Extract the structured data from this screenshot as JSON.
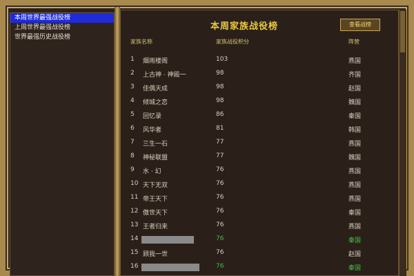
{
  "left_panel": {
    "items": [
      {
        "label": "本周世界最强战役榜",
        "selected": true
      },
      {
        "label": "上周世界最强战役榜",
        "selected": false
      },
      {
        "label": "世界最强历史战役榜",
        "selected": false
      }
    ]
  },
  "main": {
    "title": "本周家族战役榜",
    "action_button": "查看战榜",
    "columns": {
      "name": "家族名称",
      "score": "家族战役积分",
      "camp": "阵营"
    },
    "rows": [
      {
        "rank": "1",
        "name": "烟雨楼阁",
        "score": "103",
        "camp": "燕国"
      },
      {
        "rank": "2",
        "name": "上古神 · 神殿一",
        "score": "98",
        "camp": "齐国"
      },
      {
        "rank": "3",
        "name": "佳偶天成",
        "score": "98",
        "camp": "赵国"
      },
      {
        "rank": "4",
        "name": "倾城之恋",
        "score": "98",
        "camp": "魏国"
      },
      {
        "rank": "5",
        "name": "回忆录",
        "score": "86",
        "camp": "秦国"
      },
      {
        "rank": "6",
        "name": "风华者",
        "score": "81",
        "camp": "韩国"
      },
      {
        "rank": "7",
        "name": "三生一石",
        "score": "77",
        "camp": "燕国"
      },
      {
        "rank": "8",
        "name": "神秘联盟",
        "score": "77",
        "camp": "魏国"
      },
      {
        "rank": "9",
        "name": "水 · 幻",
        "score": "76",
        "camp": "燕国"
      },
      {
        "rank": "10",
        "name": "天下无双",
        "score": "76",
        "camp": "燕国"
      },
      {
        "rank": "11",
        "name": "帝王天下",
        "score": "76",
        "camp": "燕国"
      },
      {
        "rank": "12",
        "name": "傲世天下",
        "score": "76",
        "camp": "秦国"
      },
      {
        "rank": "13",
        "name": "王者归来",
        "score": "76",
        "camp": "燕国"
      },
      {
        "rank": "14",
        "name": "",
        "score": "76",
        "camp": "秦国",
        "highlight": true
      },
      {
        "rank": "15",
        "name": "顾我一世",
        "score": "76",
        "camp": "赵国"
      },
      {
        "rank": "16",
        "name": "",
        "score": "76",
        "camp": "秦国",
        "highlight": true
      }
    ]
  }
}
